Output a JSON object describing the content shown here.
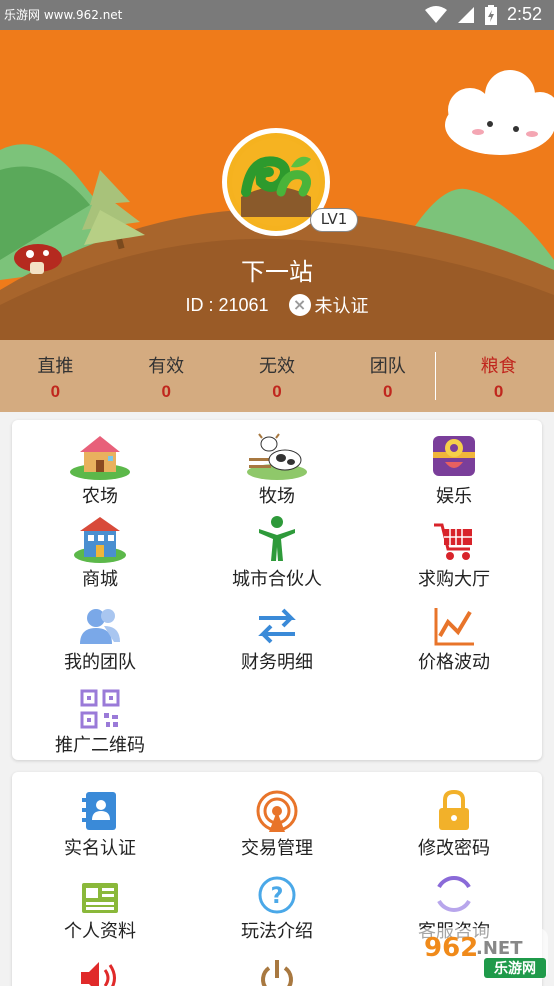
{
  "status_bar": {
    "source_text": "乐游网 www.962.net",
    "time": "2:52"
  },
  "profile": {
    "level": "LV1",
    "name": "下一站",
    "id_text": "ID : 21061",
    "cert_status": "未认证"
  },
  "stats": [
    {
      "label": "直推",
      "value": "0"
    },
    {
      "label": "有效",
      "value": "0"
    },
    {
      "label": "无效",
      "value": "0"
    },
    {
      "label": "团队",
      "value": "0"
    },
    {
      "label": "粮食",
      "value": "0"
    }
  ],
  "menu": [
    {
      "label": "农场",
      "icon": "farm-house-icon"
    },
    {
      "label": "牧场",
      "icon": "cow-ranch-icon"
    },
    {
      "label": "娱乐",
      "icon": "treasure-chest-icon"
    },
    {
      "label": "商城",
      "icon": "shop-building-icon"
    },
    {
      "label": "城市合伙人",
      "icon": "person-icon"
    },
    {
      "label": "求购大厅",
      "icon": "cart-icon"
    },
    {
      "label": "我的团队",
      "icon": "team-icon"
    },
    {
      "label": "财务明细",
      "icon": "transfer-arrows-icon"
    },
    {
      "label": "价格波动",
      "icon": "line-chart-icon"
    },
    {
      "label": "推广二维码",
      "icon": "qr-code-icon"
    }
  ],
  "settings": [
    {
      "label": "实名认证",
      "icon": "contact-book-icon"
    },
    {
      "label": "交易管理",
      "icon": "broadcast-icon"
    },
    {
      "label": "修改密码",
      "icon": "lock-icon"
    },
    {
      "label": "个人资料",
      "icon": "newspaper-icon"
    },
    {
      "label": "玩法介绍",
      "icon": "help-icon"
    },
    {
      "label": "客服咨询",
      "icon": "support-ring-icon"
    },
    {
      "label": "",
      "icon": "speaker-icon"
    },
    {
      "label": "",
      "icon": "power-icon"
    }
  ],
  "watermark": {
    "num": "962",
    "tld": ".NET",
    "cn": "乐游网"
  },
  "colors": {
    "header_bg": "#ef7b1a",
    "stats_bg": "#d4ab80",
    "accent_red": "#c0271e"
  }
}
